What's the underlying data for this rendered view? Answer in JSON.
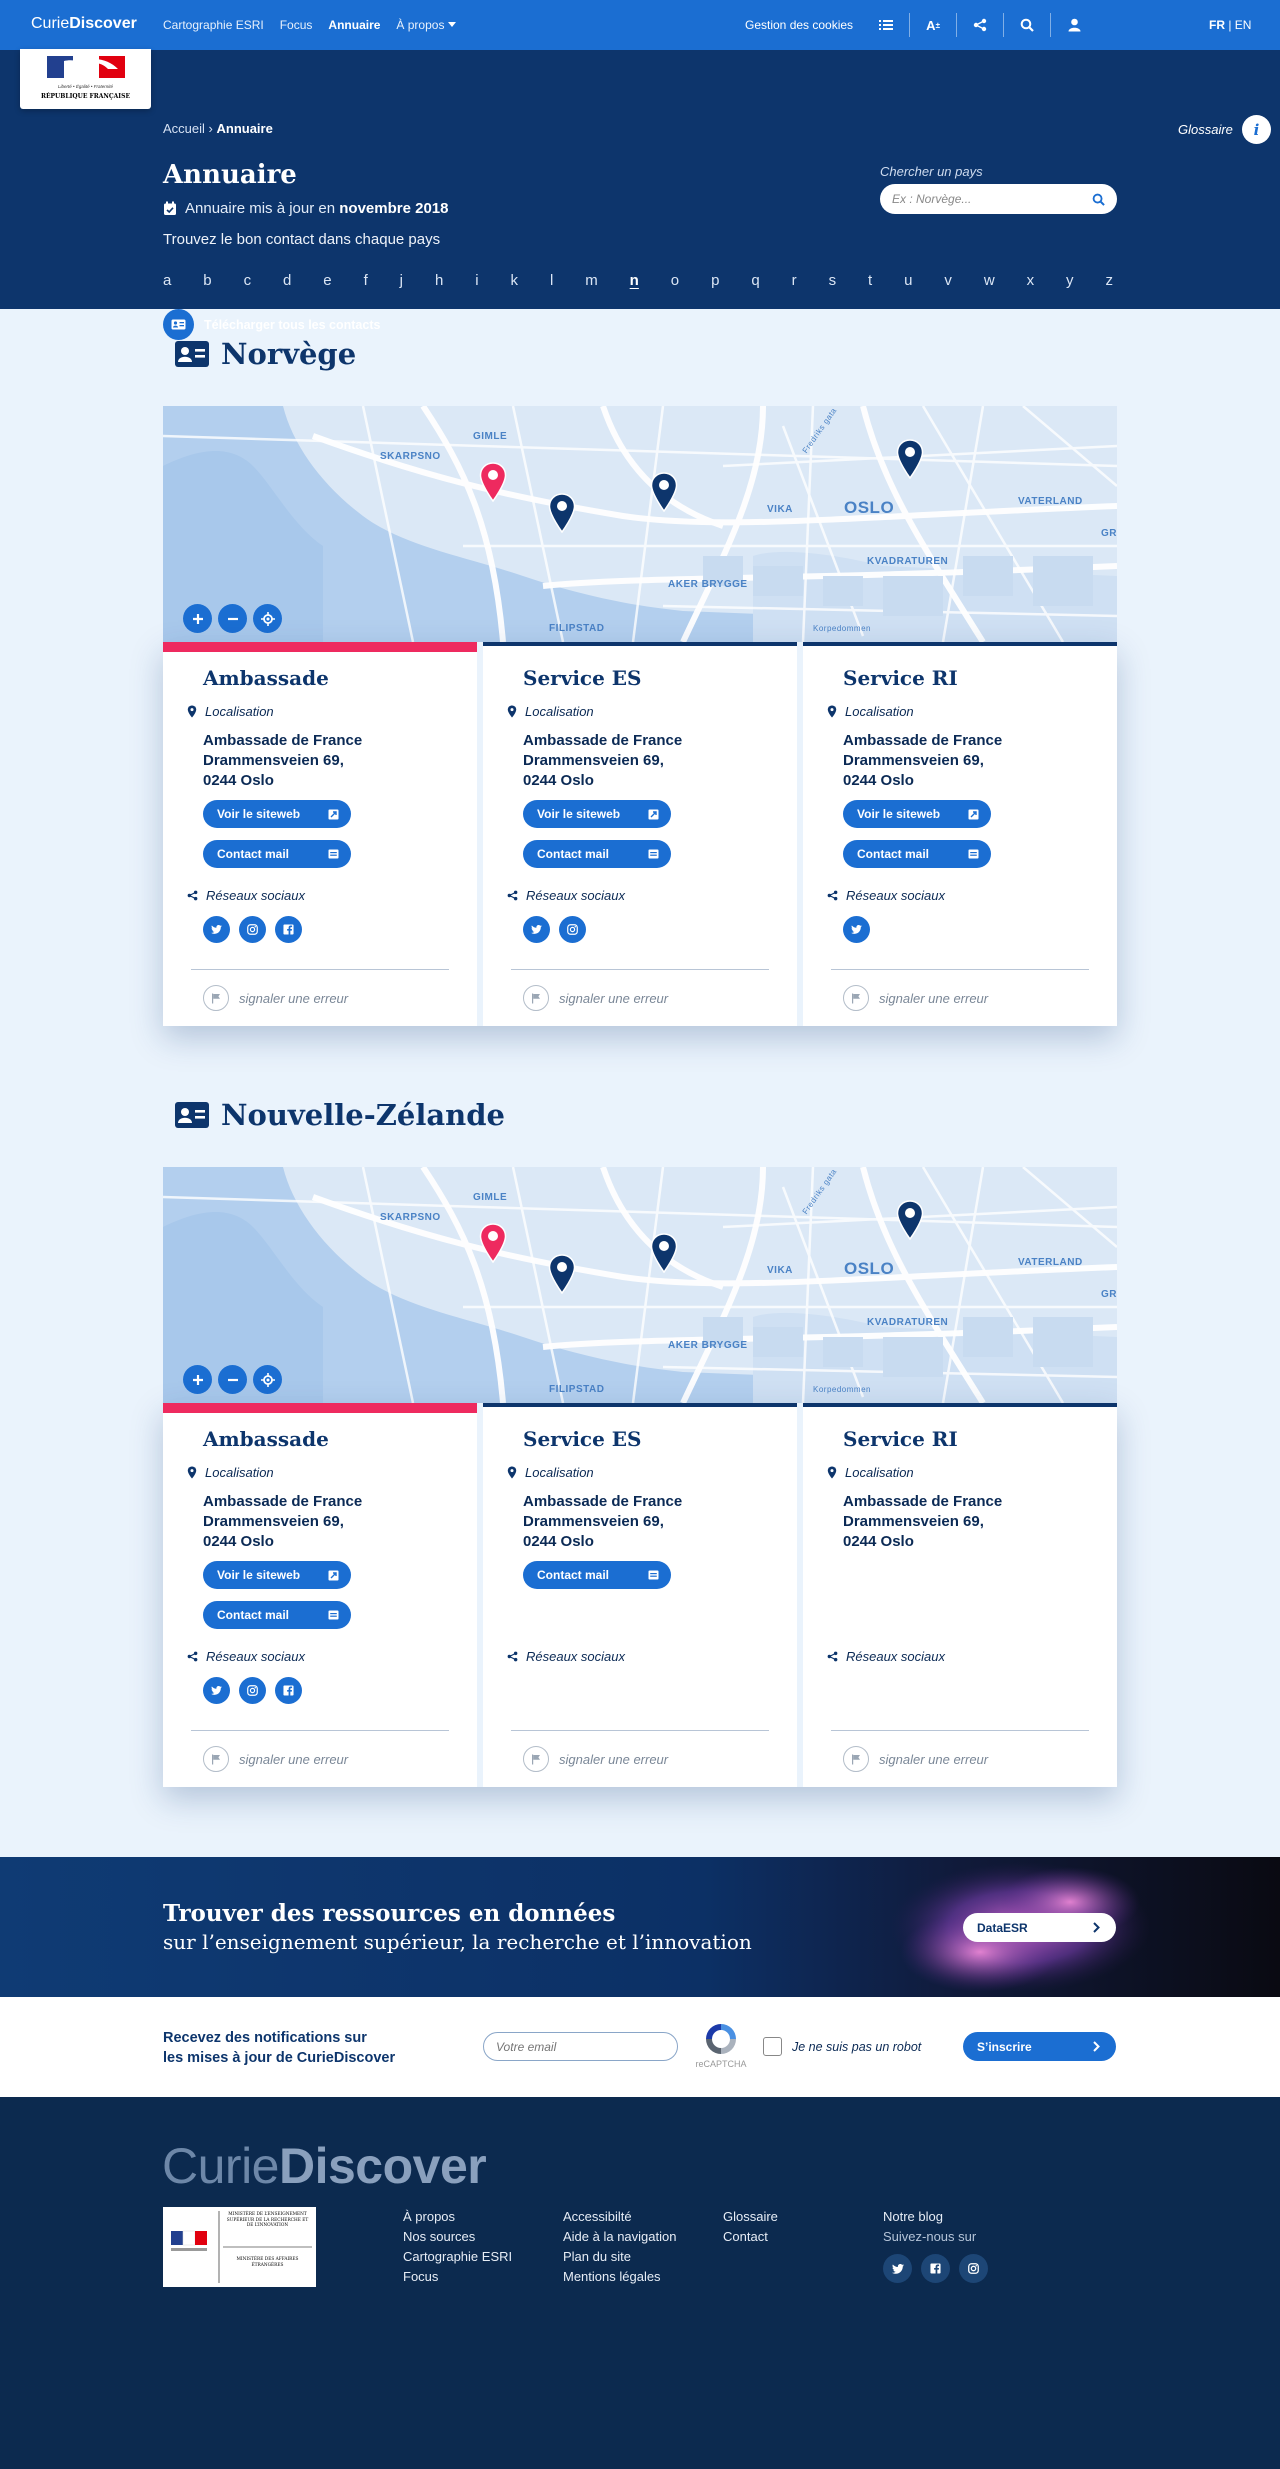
{
  "topnav": {
    "brand_a": "Curie",
    "brand_b": "Discover",
    "items": [
      "Cartographie ESRI",
      "Focus",
      "Annuaire",
      "À propos"
    ],
    "cookies": "Gestion des cookies",
    "lang_fr": "FR",
    "lang_sep": " | ",
    "lang_en": "EN"
  },
  "header": {
    "breadcrumb_home": "Accueil",
    "breadcrumb_sep": " › ",
    "breadcrumb_current": "Annuaire",
    "glossaire": "Glossaire",
    "title": "Annuaire",
    "updated_prefix": "Annuaire mis à jour en ",
    "updated_date": "novembre 2018",
    "tagline": "Trouvez le bon contact dans chaque pays",
    "search_label": "Chercher un pays",
    "search_placeholder": "Ex : Norvège...",
    "alphabet": [
      "a",
      "b",
      "c",
      "d",
      "e",
      "f",
      "j",
      "h",
      "i",
      "k",
      "l",
      "m",
      "n",
      "o",
      "p",
      "q",
      "r",
      "s",
      "t",
      "u",
      "v",
      "w",
      "x",
      "y",
      "z"
    ],
    "alphabet_current": "n",
    "download_all": "Télécharger tous les contacts"
  },
  "map_labels": {
    "skarpsno": "SKARPSNO",
    "gimle": "GIMLE",
    "vika": "VIKA",
    "oslo": "OSLO",
    "vaterland": "VATERLAND",
    "kvadraturen": "KVADRATUREN",
    "aker": "AKER BRYGGE",
    "filipstad": "FILIPSTAD",
    "korpedommen": "Korpedommen",
    "fredriks": "Fredriks gata",
    "gr": "GR"
  },
  "sections": [
    {
      "country": "Norvège",
      "cards": [
        {
          "title": "Ambassade",
          "loc_label": "Localisation",
          "addr1": "Ambassade de France",
          "addr2": "Drammensveien 69,",
          "addr3": "0244 Oslo",
          "btn_site": "Voir le siteweb",
          "btn_mail": "Contact mail",
          "social_label": "Réseaux sociaux",
          "error": "signaler une erreur"
        },
        {
          "title": "Service ES",
          "loc_label": "Localisation",
          "addr1": "Ambassade de France",
          "addr2": "Drammensveien 69,",
          "addr3": "0244 Oslo",
          "btn_site": "Voir le siteweb",
          "btn_mail": "Contact mail",
          "social_label": "Réseaux sociaux",
          "error": "signaler une erreur"
        },
        {
          "title": "Service RI",
          "loc_label": "Localisation",
          "addr1": "Ambassade de France",
          "addr2": "Drammensveien 69,",
          "addr3": "0244 Oslo",
          "btn_site": "Voir le siteweb",
          "btn_mail": "Contact mail",
          "social_label": "Réseaux sociaux",
          "error": "signaler une erreur"
        }
      ]
    },
    {
      "country": "Nouvelle-Zélande",
      "cards": [
        {
          "title": "Ambassade",
          "loc_label": "Localisation",
          "addr1": "Ambassade de France",
          "addr2": "Drammensveien 69,",
          "addr3": "0244 Oslo",
          "btn_site": "Voir le siteweb",
          "btn_mail": "Contact mail",
          "social_label": "Réseaux sociaux",
          "error": "signaler une erreur"
        },
        {
          "title": "Service ES",
          "loc_label": "Localisation",
          "addr1": "Ambassade de France",
          "addr2": "Drammensveien 69,",
          "addr3": "0244 Oslo",
          "btn_mail": "Contact mail",
          "social_label": "Réseaux sociaux",
          "error": "signaler une erreur"
        },
        {
          "title": "Service RI",
          "loc_label": "Localisation",
          "addr1": "Ambassade de France",
          "addr2": "Drammensveien 69,",
          "addr3": "0244 Oslo",
          "social_label": "Réseaux sociaux",
          "error": "signaler une erreur"
        }
      ]
    }
  ],
  "banner": {
    "title": "Trouver des ressources en données",
    "subtitle": "sur l’enseignement supérieur, la recherche et l’innovation",
    "button": "DataESR"
  },
  "newsletter": {
    "line1": "Recevez des notifications sur",
    "line2": "les mises à jour de CurieDiscover",
    "email_placeholder": "Votre email",
    "recaptcha": "reCAPTCHA",
    "robot": "Je ne suis pas un robot",
    "subscribe": "S’inscrire"
  },
  "footer": {
    "brand_a": "Curie",
    "brand_b": "Discover",
    "logo_top": "MINISTÈRE DE L’ENSEIGNEMENT SUPÉRIEUR DE LA RECHERCHE ET DE L’INNOVATION",
    "logo_bottom": "MINISTÈRE DES AFFAIRES ÉTRANGÈRES",
    "col1": [
      "À propos",
      "Nos sources",
      "Cartographie ESRI",
      "Focus"
    ],
    "col2": [
      "Accessibilté",
      "Aide à la navigation",
      "Plan du site",
      "Mentions légales"
    ],
    "col3": [
      "Glossaire",
      "Contact"
    ],
    "blog": "Notre blog",
    "follow": "Suivez-nous sur"
  },
  "logo": {
    "line1": "Liberté • Égalité • Fraternité",
    "line2": "RÉPUBLIQUE FRANÇAISE"
  },
  "colors": {
    "primary": "#1b6ed2",
    "navy": "#0d356c",
    "accent_red": "#ee2a5f",
    "background": "#eaf3fc"
  }
}
